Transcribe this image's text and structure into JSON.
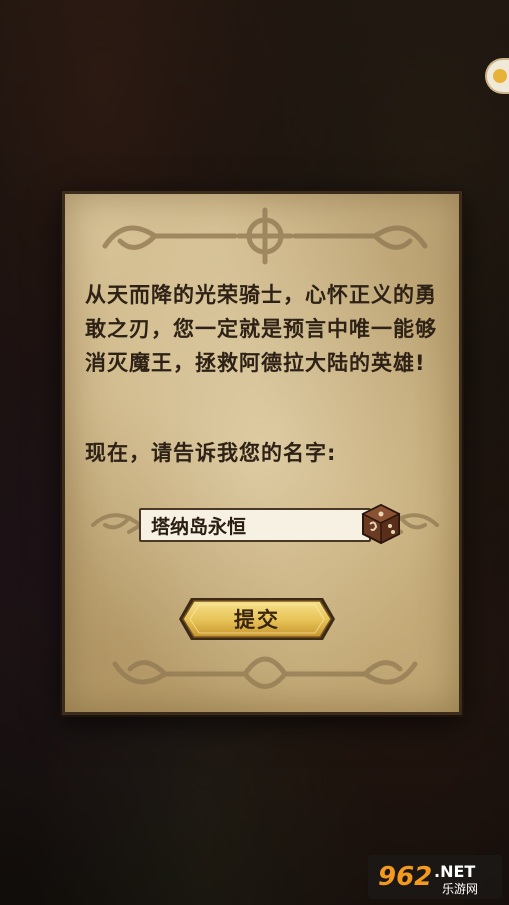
{
  "dialog": {
    "intro": "从天而降的光荣骑士，心怀正义的勇敢之刃，您一定就是预言中唯一能够消灭魔王，拯救阿德拉大陆的英雄!",
    "prompt": "现在，请告诉我您的名字:",
    "name_value": "塔纳岛永恒",
    "submit_label": "提交"
  },
  "watermark": {
    "text": "962.NET 乐游网"
  },
  "colors": {
    "parchment": "#cdb687",
    "ink": "#2e2216",
    "button_gold": "#e8c55a",
    "watermark_orange": "#f39a1e"
  },
  "icons": {
    "dice": "dice-icon",
    "badge": "badge-icon"
  }
}
